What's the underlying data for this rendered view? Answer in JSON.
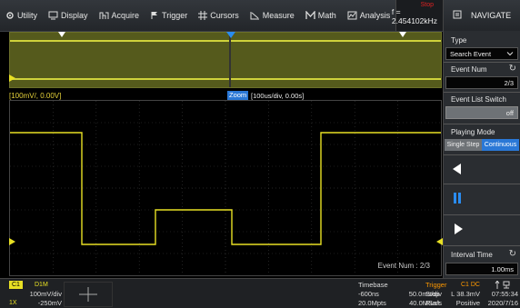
{
  "menu": {
    "items": [
      {
        "label": "Utility",
        "icon": "gear-icon"
      },
      {
        "label": "Display",
        "icon": "monitor-icon"
      },
      {
        "label": "Acquire",
        "icon": "acquire-icon"
      },
      {
        "label": "Trigger",
        "icon": "flag-icon"
      },
      {
        "label": "Cursors",
        "icon": "cursors-icon"
      },
      {
        "label": "Measure",
        "icon": "measure-icon"
      },
      {
        "label": "Math",
        "icon": "math-icon"
      },
      {
        "label": "Analysis",
        "icon": "analysis-icon"
      }
    ],
    "trigger_status": "Stop",
    "frequency": "f = 2.454102kHz"
  },
  "panel": {
    "title": "NAVIGATE",
    "type_label": "Type",
    "type_value": "Search Event",
    "event_num_label": "Event Num",
    "event_num_value": "2/3",
    "event_list_label": "Event List Switch",
    "event_list_value": "off",
    "playing_mode_label": "Playing Mode",
    "playing_mode_options": [
      "Single Step",
      "Continuous"
    ],
    "interval_label": "Interval Time",
    "interval_value": "1.00ms"
  },
  "display": {
    "zoom_channel_label": "[100mV/, 0.00V]",
    "zoom_badge": "Zoom",
    "zoom_scale": "[100us/div, 0.00s]",
    "event_num_text": "Event Num : 2/3"
  },
  "status": {
    "channel": "C1",
    "coupling": "D1M",
    "volts_div": "100mV/div",
    "offset": "-250mV",
    "probe": "1X",
    "timebase_label": "Timebase",
    "timebase_delay": "-600ns",
    "timebase_scale": "50.0ms/div",
    "sample_points": "20.0Mpts",
    "sample_rate": "40.0MSa/s",
    "trigger_label": "Trigger",
    "trigger_channel": "C1 DC",
    "trigger_state": "Stop",
    "trigger_level": "L 38.3mV",
    "trigger_mode": "Runt",
    "trigger_slope": "Positive",
    "time": "07:55:34",
    "date": "2020/7/16"
  },
  "colors": {
    "trace": "#e8e024",
    "accent": "#2a78d6",
    "trigger_text": "#ff9900"
  }
}
